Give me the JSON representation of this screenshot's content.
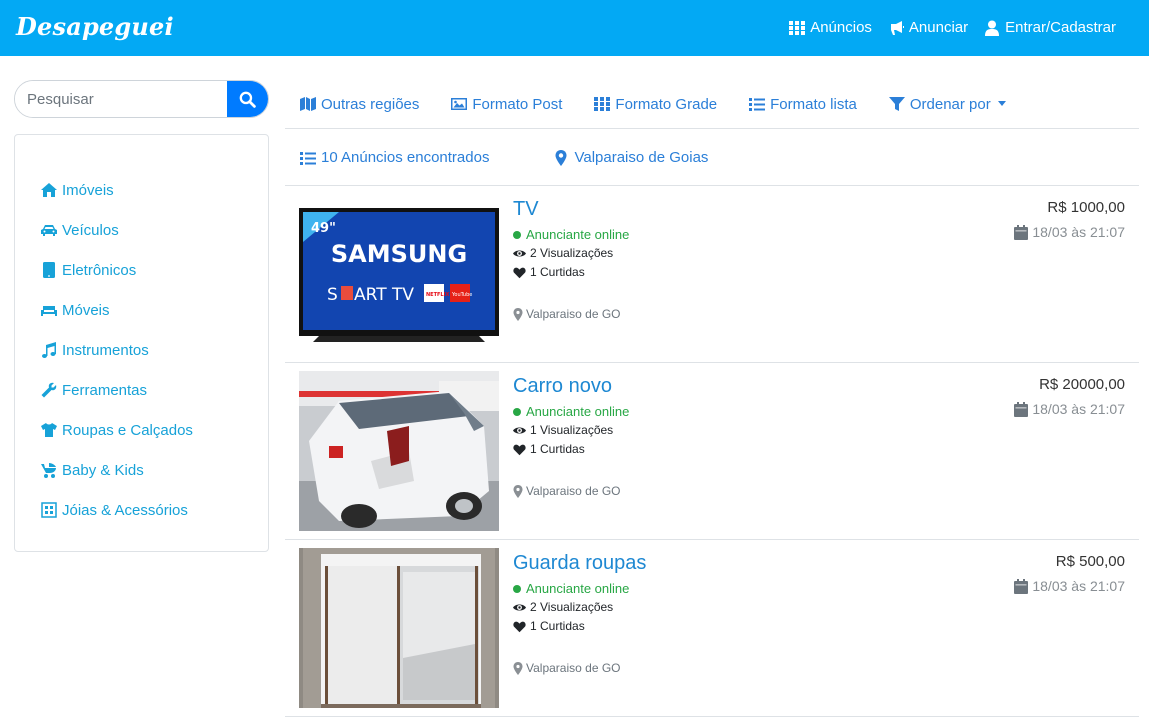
{
  "brand": "Desapeguei",
  "topnav": {
    "anuncios": "Anúncios",
    "anunciar": "Anunciar",
    "entrar": "Entrar/Cadastrar"
  },
  "search": {
    "placeholder": "Pesquisar"
  },
  "categories": [
    {
      "label": "Imóveis",
      "icon": "home-icon"
    },
    {
      "label": "Veículos",
      "icon": "car-icon"
    },
    {
      "label": "Eletrônicos",
      "icon": "tablet-icon"
    },
    {
      "label": "Móveis",
      "icon": "couch-icon"
    },
    {
      "label": "Instrumentos",
      "icon": "music-icon"
    },
    {
      "label": "Ferramentas",
      "icon": "wrench-icon"
    },
    {
      "label": "Roupas e Calçados",
      "icon": "tshirt-icon"
    },
    {
      "label": "Baby & Kids",
      "icon": "baby-carriage-icon"
    },
    {
      "label": "Jóias & Acessórios",
      "icon": "gem-icon"
    }
  ],
  "toolbar": {
    "outras_regioes": "Outras regiões",
    "formato_post": "Formato Post",
    "formato_grade": "Formato Grade",
    "formato_lista": "Formato lista",
    "ordenar": "Ordenar por"
  },
  "info": {
    "count": "10 Anúncios encontrados",
    "location": "Valparaiso de Goias"
  },
  "listings": [
    {
      "title": "TV",
      "status": "Anunciante online",
      "views": "2 Visualizações",
      "likes": "1 Curtidas",
      "location": "Valparaiso de GO",
      "price": "R$ 1000,00",
      "date": "18/03 às 21:07",
      "image": {
        "badge": "49\"",
        "brand": "SAMSUNG",
        "model_prefix": "S",
        "model_suffix": "ART TV",
        "app1": "NETFLIX",
        "app2": "YouTube"
      }
    },
    {
      "title": "Carro novo",
      "status": "Anunciante online",
      "views": "1 Visualizações",
      "likes": "1 Curtidas",
      "location": "Valparaiso de GO",
      "price": "R$ 20000,00",
      "date": "18/03 às 21:07"
    },
    {
      "title": "Guarda roupas",
      "status": "Anunciante online",
      "views": "2 Visualizações",
      "likes": "1 Curtidas",
      "location": "Valparaiso de GO",
      "price": "R$ 500,00",
      "date": "18/03 às 21:07"
    }
  ],
  "colors": {
    "header": "#03a9f4",
    "link": "#2b7fd8",
    "category": "#17a2d8",
    "online": "#28a745",
    "search_button": "#007bff"
  }
}
